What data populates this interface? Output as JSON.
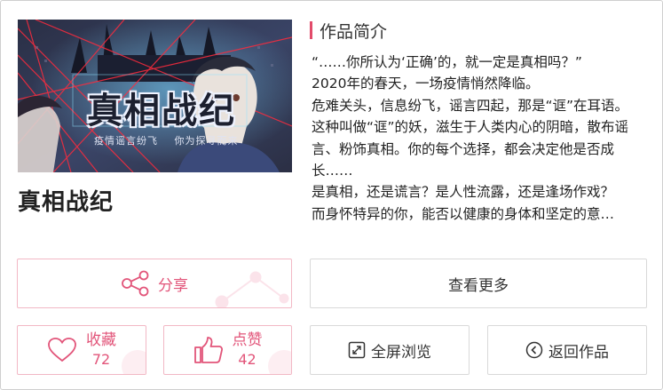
{
  "cover": {
    "title": "真相战纪",
    "subtitle_left": "疫情谣言纷飞",
    "subtitle_right": "你为探寻而来"
  },
  "work": {
    "title": "真相战纪"
  },
  "intro": {
    "heading": "作品简介",
    "paragraphs": [
      "“……你所认为‘正确’的，就一定是真相吗？”",
      "2020年的春天，一场疫情悄然降临。",
      "危难关头，信息纷飞，谣言四起，那是“诓”在耳语。这种叫做“诓”的妖，滋生于人类内心的阴暗，散布谣言、粉饰真相。你的每个选择，都会决定他是否成长……",
      "是真相，还是谎言？是人性流露，还是逢场作戏？",
      "而身怀特异的你，能否以健康的身体和坚定的意…"
    ]
  },
  "actions": {
    "share": "分享",
    "more": "查看更多",
    "favorite": {
      "label": "收藏",
      "count": "72"
    },
    "like": {
      "label": "点赞",
      "count": "42"
    },
    "fullscreen": "全屏浏览",
    "back": "返回作品"
  },
  "icons": {
    "share": "share-icon",
    "favorite": "heart-icon",
    "like": "thumbs-up-icon",
    "fullscreen": "expand-icon",
    "back": "chevron-left-circle-icon"
  },
  "colors": {
    "accent": "#e24b6a",
    "accent_light": "#f2b8c5"
  }
}
